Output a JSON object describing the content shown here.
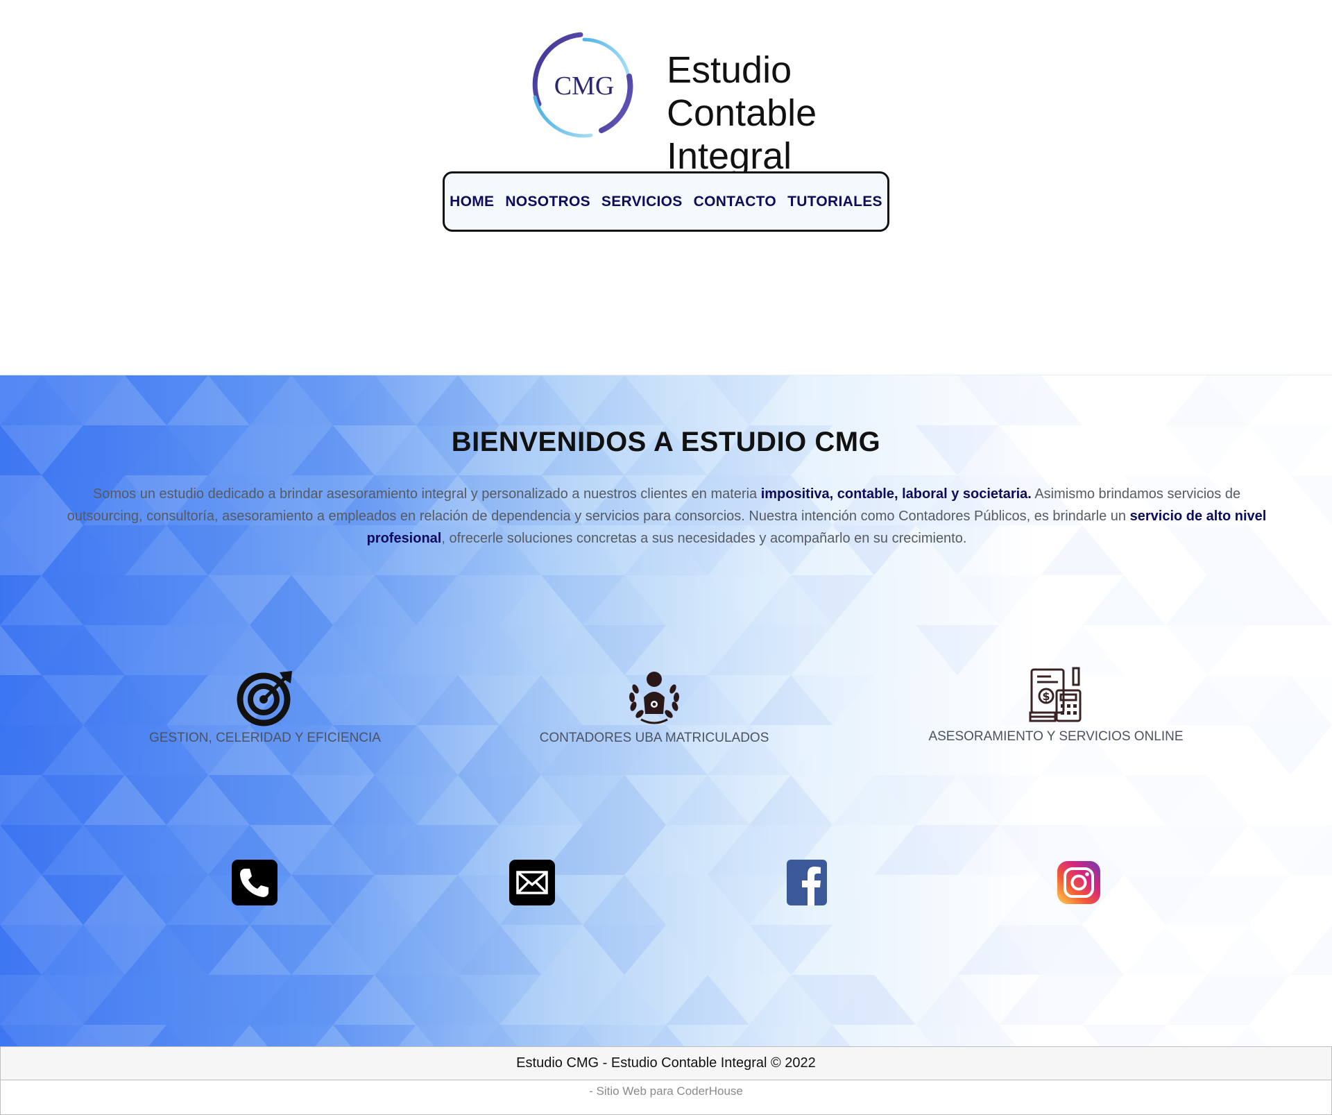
{
  "brand": {
    "logo_text": "CMG",
    "name_line1": "Estudio",
    "name_line2": "Contable",
    "name_line3": "Integral"
  },
  "nav": {
    "items": [
      {
        "label": "HOME"
      },
      {
        "label": "NOSOTROS"
      },
      {
        "label": "SERVICIOS"
      },
      {
        "label": "CONTACTO"
      },
      {
        "label": "TUTORIALES"
      }
    ]
  },
  "main": {
    "title": "BIENVENIDOS A ESTUDIO CMG",
    "intro": {
      "p1": "Somos un estudio dedicado a brindar asesoramiento integral y personalizado a nuestros clientes en materia ",
      "b1": "impositiva, contable, laboral y societaria.",
      "p2": " Asimismo brindamos servicios de outsourcing, consultoría, asesoramiento a empleados en relación de dependencia y servicios para consorcios. Nuestra intención como Contadores Públicos, es brindarle un ",
      "b2": "servicio de alto nivel profesional",
      "p3": ", ofrecerle soluciones concretas a sus necesidades y acompañarlo en su crecimiento."
    },
    "features": [
      {
        "label": "GESTION, CELERIDAD Y EFICIENCIA",
        "icon": "target-icon"
      },
      {
        "label": "CONTADORES UBA MATRICULADOS",
        "icon": "graduate-laurel-icon"
      },
      {
        "label": "ASESORAMIENTO Y SERVICIOS ONLINE",
        "icon": "accounting-documents-icon"
      }
    ],
    "socials": [
      {
        "name": "phone",
        "icon": "phone-icon"
      },
      {
        "name": "email",
        "icon": "email-icon"
      },
      {
        "name": "facebook",
        "icon": "facebook-icon",
        "color": "#3b5998"
      },
      {
        "name": "instagram",
        "icon": "instagram-icon"
      }
    ]
  },
  "footer": {
    "copyright": "Estudio CMG - Estudio Contable Integral © 2022",
    "credit": "- Sitio Web para CoderHouse"
  },
  "colors": {
    "accent_navy": "#0d0b5c",
    "background_blue": "#2f6df2",
    "nav_background": "#f3f9fd"
  }
}
